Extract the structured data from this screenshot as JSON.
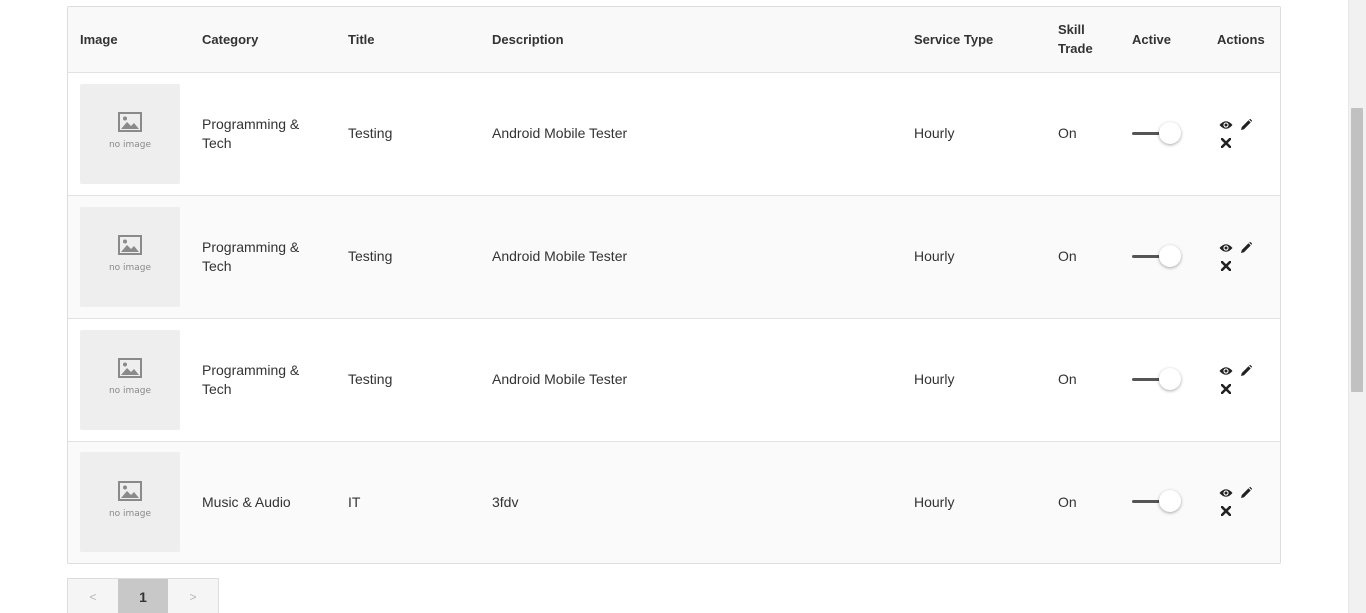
{
  "table": {
    "headers": {
      "image": "Image",
      "category": "Category",
      "title": "Title",
      "description": "Description",
      "service_type": "Service Type",
      "skill_trade": "Skill Trade",
      "active": "Active",
      "actions": "Actions"
    },
    "rows": [
      {
        "image_caption": "no image",
        "category": "Programming & Tech",
        "title": "Testing",
        "description": "Android Mobile Tester",
        "service_type": "Hourly",
        "skill_trade": "On",
        "active": true
      },
      {
        "image_caption": "no image",
        "category": "Programming & Tech",
        "title": "Testing",
        "description": "Android Mobile Tester",
        "service_type": "Hourly",
        "skill_trade": "On",
        "active": true
      },
      {
        "image_caption": "no image",
        "category": "Programming & Tech",
        "title": "Testing",
        "description": "Android Mobile Tester",
        "service_type": "Hourly",
        "skill_trade": "On",
        "active": true
      },
      {
        "image_caption": "no image",
        "category": "Music & Audio",
        "title": "IT",
        "description": "3fdv",
        "service_type": "Hourly",
        "skill_trade": "On",
        "active": true
      }
    ],
    "action_icons": [
      "eye-icon",
      "pencil-icon",
      "close-icon"
    ]
  },
  "pagination": {
    "prev": "<",
    "current": "1",
    "next": ">"
  },
  "colors": {
    "header_bg": "#f9f9f9",
    "border": "#dddddd",
    "toggle_track": "#555555",
    "pager_current": "#c8c8c8"
  }
}
